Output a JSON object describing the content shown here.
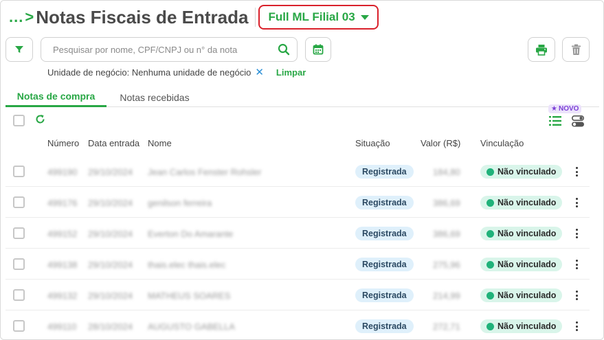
{
  "header": {
    "breadcrumb_dots": "...",
    "breadcrumb_chevron": ">",
    "title": "Notas Fiscais de Entrada",
    "branch": "Full ML Filial 03"
  },
  "search": {
    "placeholder": "Pesquisar por nome, CPF/CNPJ ou n° da nota",
    "value": ""
  },
  "filters": {
    "label": "Unidade de negócio: Nenhuma unidade de negócio",
    "remove": "✕",
    "clear": "Limpar"
  },
  "tabs": [
    {
      "label": "Notas de compra",
      "active": true
    },
    {
      "label": "Notas recebidas",
      "active": false
    }
  ],
  "badge_new": "NOVO",
  "columns": {
    "numero": "Número",
    "data": "Data entrada",
    "nome": "Nome",
    "situacao": "Situação",
    "valor": "Valor (R$)",
    "vinculacao": "Vinculação"
  },
  "rows": [
    {
      "numero": "499190",
      "data": "29/10/2024",
      "nome": "Jean Carlos Fenster Rohsler",
      "situacao": "Registrada",
      "valor": "184,80",
      "vinculacao": "Não vinculado"
    },
    {
      "numero": "499176",
      "data": "29/10/2024",
      "nome": "genilson ferreira",
      "situacao": "Registrada",
      "valor": "386,69",
      "vinculacao": "Não vinculado"
    },
    {
      "numero": "499152",
      "data": "29/10/2024",
      "nome": "Everton Do Amarante",
      "situacao": "Registrada",
      "valor": "386,69",
      "vinculacao": "Não vinculado"
    },
    {
      "numero": "499138",
      "data": "29/10/2024",
      "nome": "thais.elec thais.elec",
      "situacao": "Registrada",
      "valor": "275,96",
      "vinculacao": "Não vinculado"
    },
    {
      "numero": "499132",
      "data": "29/10/2024",
      "nome": "MATHEUS SOARES",
      "situacao": "Registrada",
      "valor": "214,99",
      "vinculacao": "Não vinculado"
    },
    {
      "numero": "499110",
      "data": "28/10/2024",
      "nome": "AUGUSTO GABELLA",
      "situacao": "Registrada",
      "valor": "272,71",
      "vinculacao": "Não vinculado"
    }
  ],
  "colors": {
    "accent_green": "#28a745",
    "highlight_red": "#d9202a",
    "status_blue_bg": "#dff0fb",
    "link_green_bg": "#d9f5ea",
    "new_purple": "#7b3fd6"
  },
  "icons": {
    "filter": "filter-icon",
    "search": "search-icon",
    "calendar": "calendar-icon",
    "print": "printer-icon",
    "delete": "trash-icon",
    "refresh": "refresh-icon",
    "list_view": "list-icon",
    "toggle_view": "toggle-icon",
    "more": "kebab-icon",
    "star": "star-icon"
  }
}
